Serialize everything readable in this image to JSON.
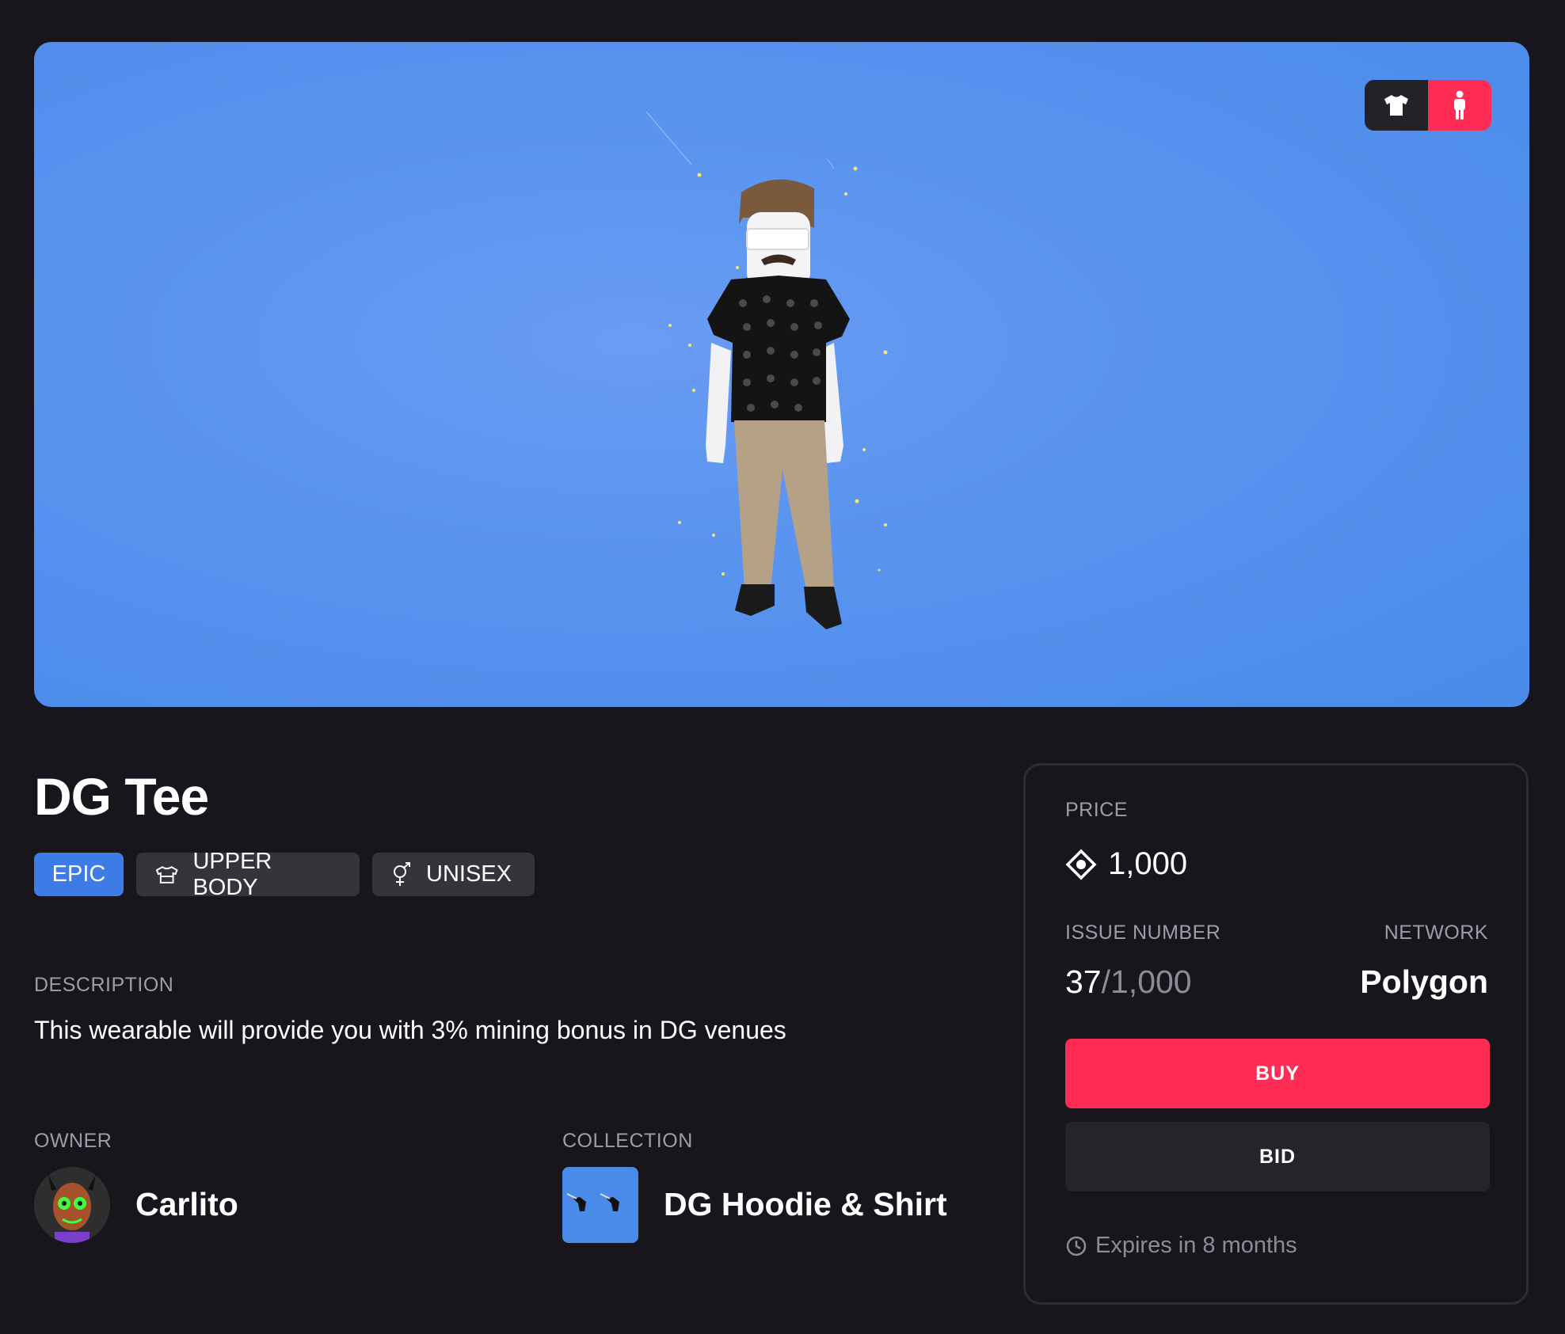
{
  "item": {
    "title": "DG Tee",
    "rarity": "EPIC",
    "category": "UPPER BODY",
    "gender": "UNISEX",
    "description_label": "DESCRIPTION",
    "description": "This wearable will provide you with 3% mining bonus in DG venues"
  },
  "owner": {
    "label": "OWNER",
    "name": "Carlito"
  },
  "collection": {
    "label": "COLLECTION",
    "name": "DG Hoodie & Shirt"
  },
  "order": {
    "price_label": "PRICE",
    "price": "1,000",
    "issue_label": "ISSUE NUMBER",
    "issue_number": "37",
    "issue_total": "/1,000",
    "network_label": "NETWORK",
    "network": "Polygon",
    "buy_label": "BUY",
    "bid_label": "BID",
    "expires": "Expires in 8 months"
  },
  "colors": {
    "background": "#18161c",
    "accent": "#ff2d55",
    "rarity_epic": "#3d7ce6",
    "preview_bg": "#4a8ae9"
  },
  "icons": [
    "shirt-icon",
    "avatar-icon",
    "upper-body-icon",
    "unisex-icon",
    "mana-icon",
    "clock-icon"
  ]
}
